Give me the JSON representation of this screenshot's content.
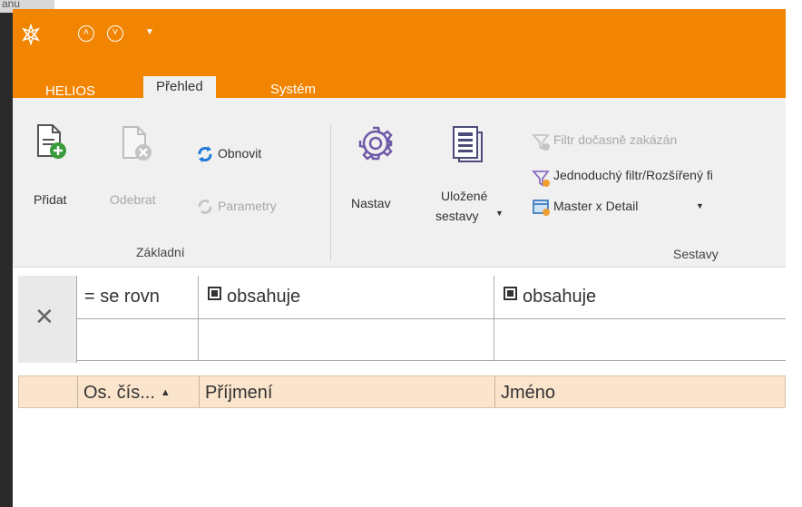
{
  "background": {
    "corner_text": "anu"
  },
  "titlebar": {
    "color": "#f18400",
    "icons": [
      "app-logo-icon",
      "circle-up-icon",
      "circle-down-icon",
      "quick-access-dropdown-icon"
    ]
  },
  "tabs": [
    {
      "label": "HELIOS",
      "active": false
    },
    {
      "label": "Přehled",
      "active": true
    },
    {
      "label": "Systém",
      "active": false
    }
  ],
  "ribbon": {
    "zakladni": {
      "title": "Základní",
      "pridat": "Přidat",
      "odebrat": "Odebrat",
      "obnovit": "Obnovit",
      "parametry": "Parametry"
    },
    "sestavy": {
      "title": "Sestavy",
      "nastav": "Nastav",
      "ulozene_line1": "Uložené",
      "ulozene_line2": "sestavy",
      "filtr_docasne": "Filtr dočasně zakázán",
      "jednoduchy_filtr": "Jednoduchý filtr/Rozšířený fi",
      "master_detail": "Master x Detail"
    }
  },
  "filter": {
    "clear_icon": "close-icon",
    "col1_operator": "= se rovn",
    "col2_operator": "obsahuje",
    "col3_operator": "obsahuje",
    "col1_value": "",
    "col2_value": "",
    "col3_value": ""
  },
  "grid": {
    "header_color": "#fbe4cc",
    "columns": [
      {
        "label": "Os. čís...",
        "sorted": "ascending"
      },
      {
        "label": "Příjmení"
      },
      {
        "label": "Jméno"
      }
    ]
  }
}
